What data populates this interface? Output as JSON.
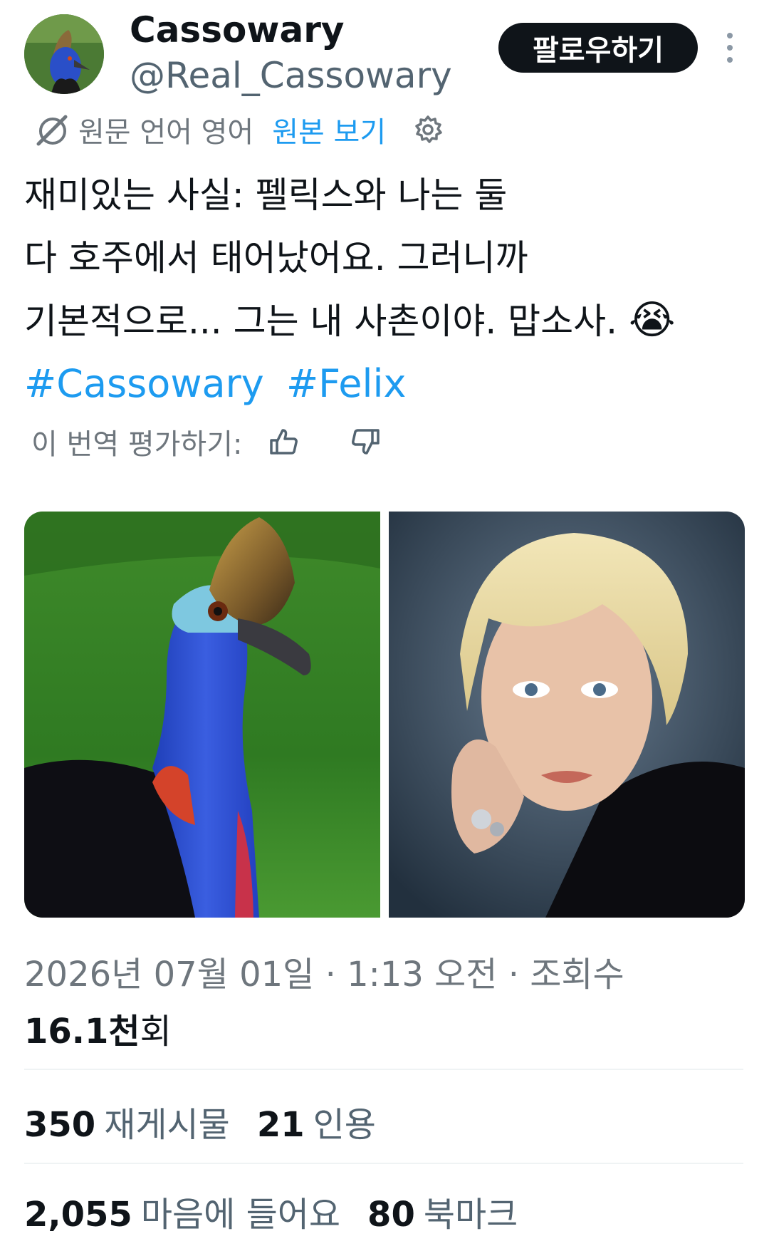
{
  "author": {
    "display_name": "Cassowary",
    "handle": "@Real_Cassowary",
    "follow_label": "팔로우하기"
  },
  "translation": {
    "source_language": "원문 언어 영어",
    "show_original_label": "원본 보기"
  },
  "tweet": {
    "lines": [
      "재미있는 사실: 펠릭스와 나는 둘",
      "다 호주에서 태어났어요. 그러니까",
      "기본적으로... 그는 내 사촌이야. 맙소사."
    ],
    "emoji": "😭",
    "hashtags": [
      "#Cassowary",
      "#Felix"
    ]
  },
  "rating": {
    "label": "이 번역 평가하기:"
  },
  "meta": {
    "datetime": "2026년 07월 01일 · 1:13 오전 · 조회수",
    "views_number": "16.1천",
    "views_suffix": "회"
  },
  "stats": {
    "reposts": {
      "value": "350",
      "label": "재게시물"
    },
    "quotes": {
      "value": "21",
      "label": "인용"
    },
    "likes": {
      "value": "2,055",
      "label": "마음에 들어요"
    },
    "bookmarks": {
      "value": "80",
      "label": "북마크"
    }
  },
  "colors": {
    "accent": "#1d9bf0",
    "text_primary": "#0f1419",
    "text_secondary": "#536471",
    "button_dark": "#0f1419"
  },
  "icons": [
    "translate-icon",
    "gear-icon",
    "thumbs-up-icon",
    "thumbs-down-icon",
    "more-options-icon"
  ]
}
